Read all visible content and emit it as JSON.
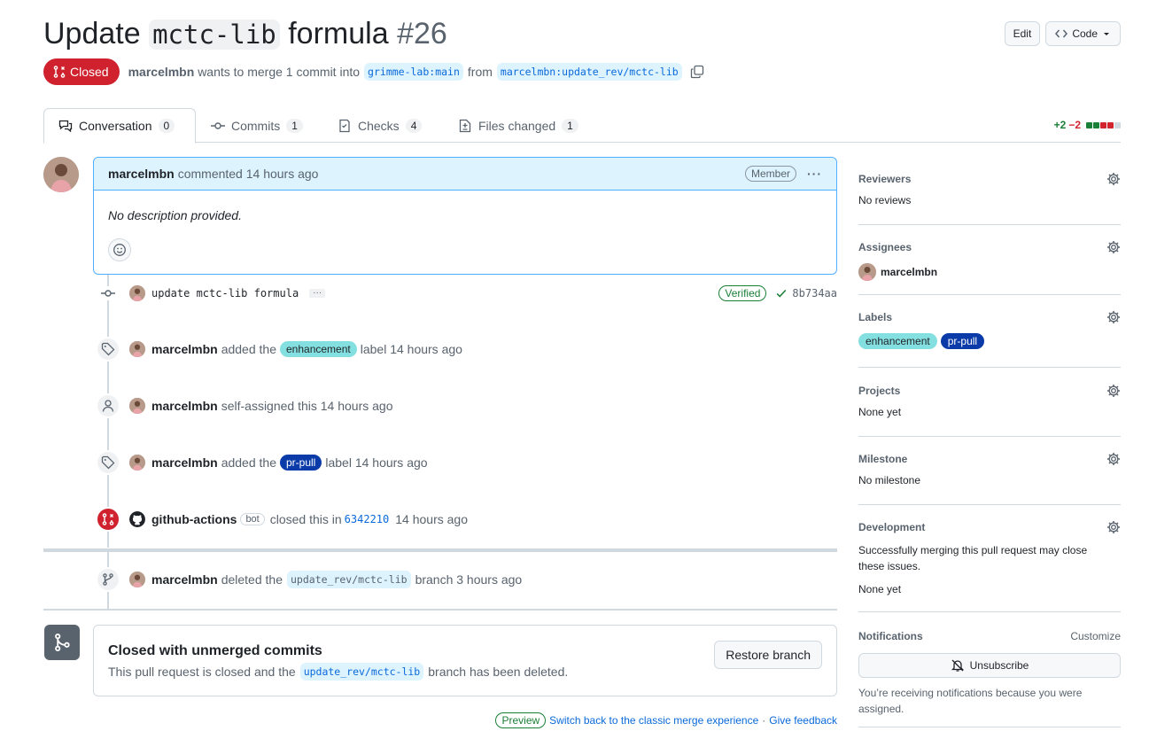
{
  "header": {
    "title_prefix": "Update",
    "title_code": "mctc-lib",
    "title_suffix": "formula",
    "number": "#26",
    "edit_label": "Edit",
    "code_label": "Code"
  },
  "meta": {
    "state": "Closed",
    "author": "marcelmbn",
    "text_merge": "wants to merge 1 commit into",
    "base_branch": "grimme-lab:main",
    "text_from": "from",
    "head_branch": "marcelmbn:update_rev/mctc-lib"
  },
  "tabs": [
    {
      "label": "Conversation",
      "count": "0"
    },
    {
      "label": "Commits",
      "count": "1"
    },
    {
      "label": "Checks",
      "count": "4"
    },
    {
      "label": "Files changed",
      "count": "1"
    }
  ],
  "diffstat": {
    "additions": "+2",
    "deletions": "−2"
  },
  "comment": {
    "author": "marcelmbn",
    "action": "commented 14 hours ago",
    "role": "Member",
    "body": "No description provided."
  },
  "commit": {
    "message": "update mctc-lib formula",
    "verified": "Verified",
    "sha": "8b734aa"
  },
  "events": {
    "e1": {
      "actor": "marcelmbn",
      "pre": "added the",
      "label": "enhancement",
      "post": "label 14 hours ago"
    },
    "e2": {
      "actor": "marcelmbn",
      "text": "self-assigned this 14 hours ago"
    },
    "e3": {
      "actor": "marcelmbn",
      "pre": "added the",
      "label": "pr-pull",
      "post": "label 14 hours ago"
    },
    "e4": {
      "actor": "github-actions",
      "bot": "bot",
      "pre": "closed this in",
      "sha": "6342210",
      "post": "14 hours ago"
    },
    "e5": {
      "actor": "marcelmbn",
      "pre": "deleted the",
      "branch": "update_rev/mctc-lib",
      "post": "branch 3 hours ago"
    }
  },
  "merge_box": {
    "title": "Closed with unmerged commits",
    "desc_pre": "This pull request is closed and the",
    "branch": "update_rev/mctc-lib",
    "desc_post": "branch has been deleted.",
    "button": "Restore branch"
  },
  "footer": {
    "preview": "Preview",
    "classic_link": "Switch back to the classic merge experience",
    "sep": "·",
    "feedback_link": "Give feedback"
  },
  "sidebar": {
    "reviewers": {
      "title": "Reviewers",
      "value": "No reviews"
    },
    "assignees": {
      "title": "Assignees",
      "value": "marcelmbn"
    },
    "labels": {
      "title": "Labels",
      "items": [
        "enhancement",
        "pr-pull"
      ]
    },
    "projects": {
      "title": "Projects",
      "value": "None yet"
    },
    "milestone": {
      "title": "Milestone",
      "value": "No milestone"
    },
    "development": {
      "title": "Development",
      "text": "Successfully merging this pull request may close these issues.",
      "value": "None yet"
    },
    "notifications": {
      "title": "Notifications",
      "customize": "Customize",
      "button": "Unsubscribe",
      "note": "You’re receiving notifications because you were assigned."
    }
  },
  "colors": {
    "closed": "#cf222e",
    "accent": "#0969da",
    "label_enhancement": "#84e0e0",
    "label_pr_pull": "#0b3ba8"
  }
}
